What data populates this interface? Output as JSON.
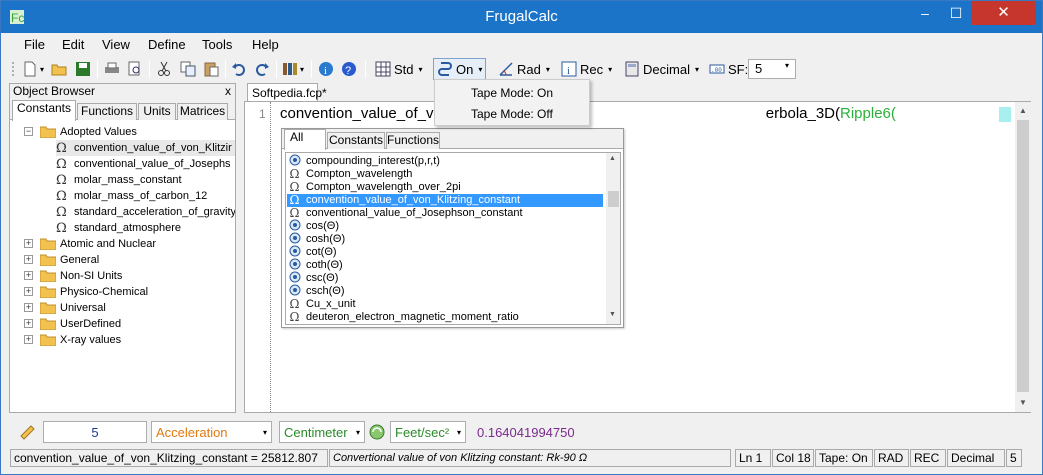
{
  "window": {
    "title": "FrugalCalc",
    "controls": {
      "minimize": "–",
      "maximize": "☐",
      "close": "✕"
    }
  },
  "menu": [
    "File",
    "Edit",
    "View",
    "Define",
    "Tools",
    "Help"
  ],
  "toolbar": {
    "std_label": "Std",
    "tape_label": "On",
    "angle_label": "Rad",
    "coord_label": "Rec",
    "format_label": "Decimal",
    "sf_label": "SF:",
    "sf_value": "5"
  },
  "tape_menu": {
    "items": [
      "Tape Mode: On",
      "Tape Mode: Off"
    ]
  },
  "object_browser": {
    "header": "Object Browser",
    "close": "x",
    "tabs": [
      "Constants",
      "Functions",
      "Units",
      "Matrices"
    ],
    "tree": {
      "group": "Adopted Values",
      "children": [
        "convention_value_of_von_Klitzir",
        "conventional_value_of_Josephs",
        "molar_mass_constant",
        "molar_mass_of_carbon_12",
        "standard_acceleration_of_gravity",
        "standard_atmosphere"
      ],
      "folders": [
        "Atomic and Nuclear",
        "General",
        "Non-SI Units",
        "Physico-Chemical",
        "Universal",
        "UserDefined",
        "X-ray values"
      ]
    }
  },
  "editor": {
    "tab": "Softpedia.fcp*",
    "line_number": "1",
    "code_prefix": "convention_value_of_vo",
    "code_suffix_func": "erbola_3D(",
    "code_suffix_arg": "Ripple6("
  },
  "autocomplete": {
    "tabs": [
      "All",
      "Constants",
      "Functions"
    ],
    "items": [
      {
        "icon": "function-icon",
        "label": "compounding_interest(p,r,t)"
      },
      {
        "icon": "omega-icon",
        "label": "Compton_wavelength"
      },
      {
        "icon": "omega-icon",
        "label": "Compton_wavelength_over_2pi"
      },
      {
        "icon": "omega-icon",
        "label": "convention_value_of_von_Klitzing_constant",
        "selected": true
      },
      {
        "icon": "omega-icon",
        "label": "conventional_value_of_Josephson_constant"
      },
      {
        "icon": "function-icon",
        "label": "cos(Θ)"
      },
      {
        "icon": "function-icon",
        "label": "cosh(Θ)"
      },
      {
        "icon": "function-icon",
        "label": "cot(Θ)"
      },
      {
        "icon": "function-icon",
        "label": "coth(Θ)"
      },
      {
        "icon": "function-icon",
        "label": "csc(Θ)"
      },
      {
        "icon": "function-icon",
        "label": "csch(Θ)"
      },
      {
        "icon": "omega-icon",
        "label": "Cu_x_unit"
      },
      {
        "icon": "omega-icon",
        "label": "deuteron_electron_magnetic_moment_ratio"
      }
    ]
  },
  "units_bar": {
    "value": "5",
    "quantity": "Acceleration",
    "unit_from": "Centimeter",
    "unit_to": "Feet/sec²",
    "result": "0.164041994750"
  },
  "status_bar": {
    "selection": "convention_value_of_von_Klitzing_constant = 25812.807",
    "description": "Convertional value of von Klitzing constant: Rk-90  Ω",
    "line": "Ln 1",
    "col": "Col 18",
    "tape": "Tape: On",
    "angle": "RAD",
    "coord": "REC",
    "format": "Decimal",
    "sf": "5"
  },
  "colors": {
    "titlebar": "#1b74c8",
    "close": "#c7362d",
    "selection": "#3399ff",
    "code_arg": "#2ab03a",
    "result": "#7a2a8a",
    "quantity": "#e07a10",
    "unit": "#2a8a2a"
  }
}
